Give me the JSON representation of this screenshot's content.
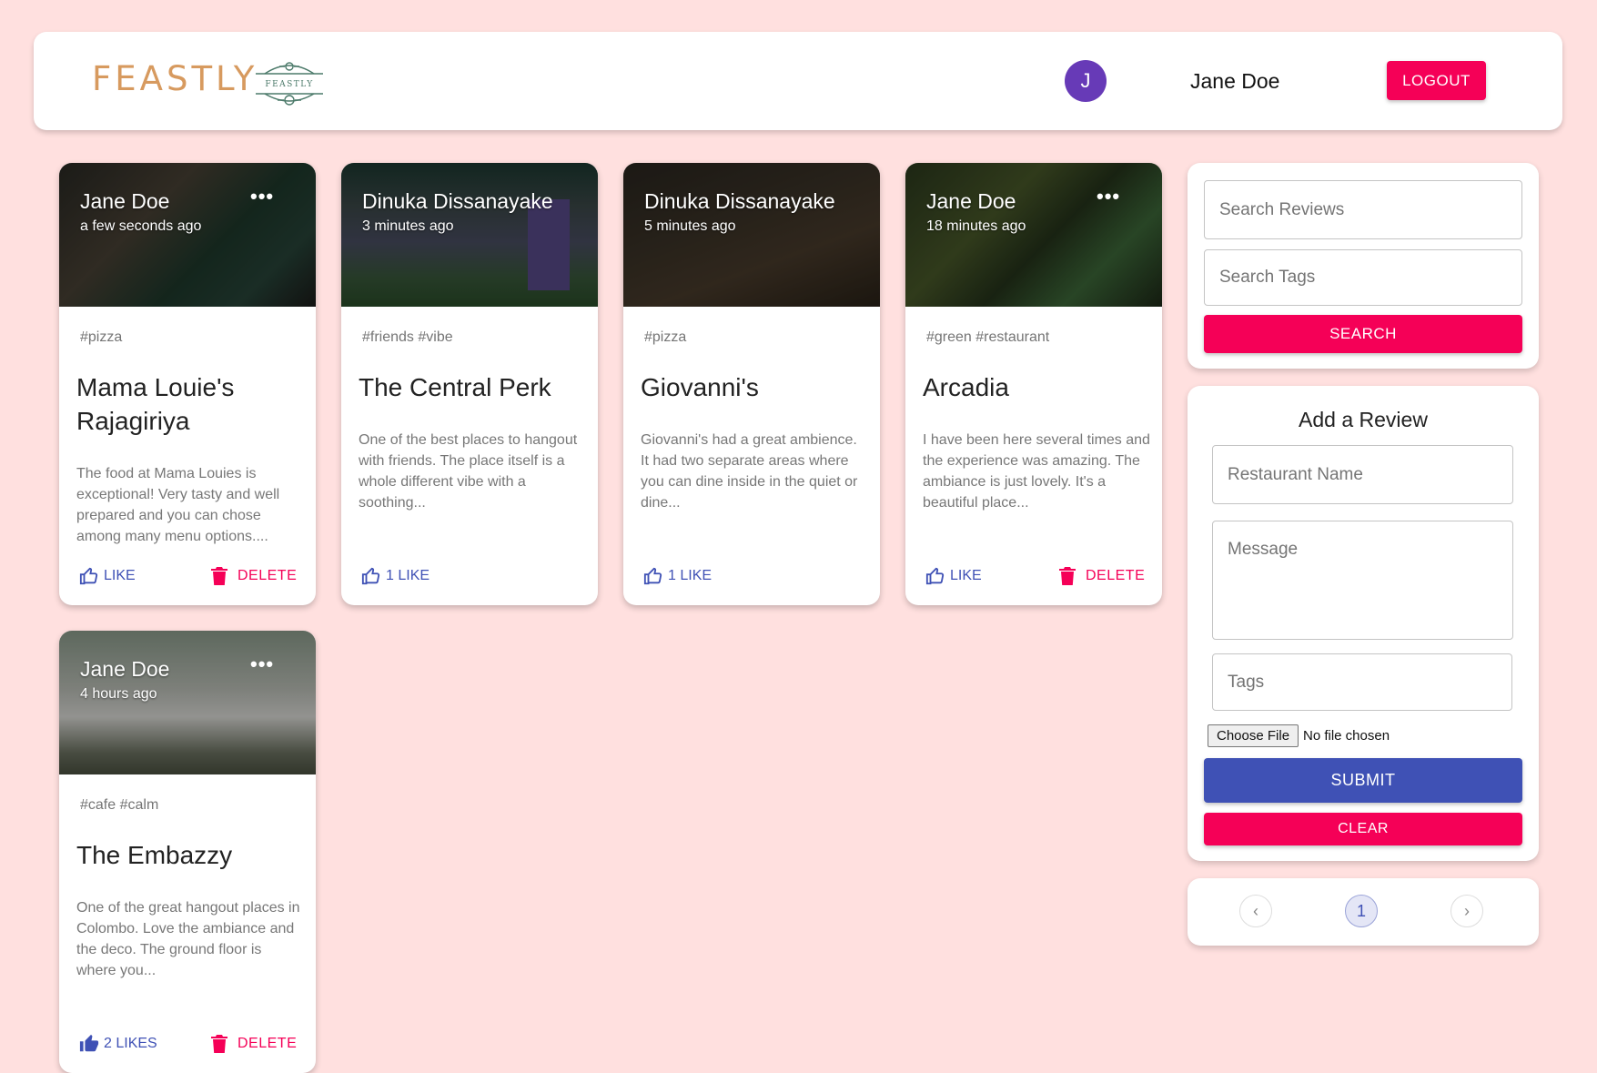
{
  "app": {
    "brand": "FEASTLY",
    "logo_text": "FEASTLY",
    "avatar_letter": "J",
    "user_name": "Jane Doe",
    "logout_label": "LOGOUT"
  },
  "posts": [
    {
      "author": "Jane Doe",
      "time": "a few seconds ago",
      "more": "•••",
      "tags": "#pizza",
      "title": "Mama Louie's Rajagiriya",
      "message": "The food at Mama Louies is exceptional! Very tasty and well prepared and you can chose among many menu options....",
      "like_label": "LIKE",
      "delete_label": "DELETE"
    },
    {
      "author": "Dinuka Dissanayake",
      "time": "3 minutes ago",
      "tags": "#friends #vibe",
      "title": "The Central Perk",
      "message": "One of the best places to hangout with friends. The place itself is a whole different vibe with a soothing...",
      "like_label": "1 LIKE"
    },
    {
      "author": "Dinuka Dissanayake",
      "time": "5 minutes ago",
      "tags": "#pizza",
      "title": "Giovanni's",
      "message": "Giovanni's had a great ambience. It had two separate areas where you can dine inside in the quiet or dine...",
      "like_label": "1 LIKE"
    },
    {
      "author": "Jane Doe",
      "time": "18 minutes ago",
      "more": "•••",
      "tags": "#green #restaurant",
      "title": "Arcadia",
      "message": "I have been here several times and the experience was amazing. The ambiance is just lovely. It's a beautiful place...",
      "like_label": "LIKE",
      "delete_label": "DELETE"
    },
    {
      "author": "Jane Doe",
      "time": "4 hours ago",
      "more": "•••",
      "tags": "#cafe #calm",
      "title": "The Embazzy",
      "message": "One of the great hangout places in Colombo. Love the ambiance and the deco. The ground floor is where you...",
      "like_label": "2 LIKES",
      "delete_label": "DELETE"
    }
  ],
  "search": {
    "reviews_placeholder": "Search Reviews",
    "tags_placeholder": "Search Tags",
    "button_label": "SEARCH"
  },
  "form": {
    "title": "Add a Review",
    "name_placeholder": "Restaurant Name",
    "message_placeholder": "Message",
    "tags_placeholder": "Tags",
    "file_button": "Choose File",
    "file_status": "No file chosen",
    "submit_label": "SUBMIT",
    "clear_label": "CLEAR"
  },
  "pagination": {
    "prev": "‹",
    "current": "1",
    "next": "›"
  },
  "colors": {
    "background": "#ffe0df",
    "primary": "#3f51b5",
    "secondary": "#f50057",
    "avatar": "#673ab7",
    "brand": "#d79a5f"
  }
}
